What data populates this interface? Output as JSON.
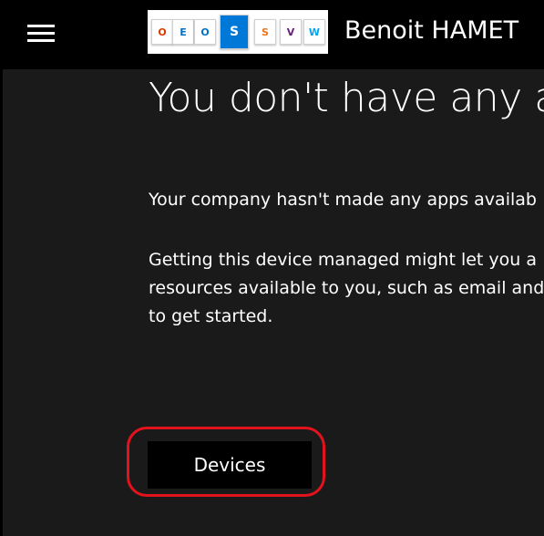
{
  "header": {
    "menu_icon": "hamburger-icon",
    "user_name": "Benoit HAMET",
    "logo_tiles": [
      {
        "icon": "office-icon",
        "glyph": "O",
        "color": "#d83b01"
      },
      {
        "icon": "exchange-icon",
        "glyph": "E",
        "color": "#0072c6"
      },
      {
        "icon": "outlook-icon",
        "glyph": "O",
        "color": "#0072c6"
      },
      {
        "icon": "sharepoint-icon",
        "glyph": "S",
        "color": "#0078d7"
      },
      {
        "icon": "swayhelper-icon",
        "glyph": "S",
        "color": "#e8741c"
      },
      {
        "icon": "visual-studio-icon",
        "glyph": "V",
        "color": "#68217a"
      },
      {
        "icon": "windows-icon",
        "glyph": "W",
        "color": "#00a4ef"
      }
    ]
  },
  "main": {
    "heading": "You don't have any a",
    "paragraph1": "Your company hasn't made any apps availab",
    "paragraph2_lines": [
      "Getting this device managed might let you a",
      "resources available to you, such as email and",
      "to get started."
    ],
    "devices_button": "Devices",
    "highlight_color": "#e3131d"
  }
}
